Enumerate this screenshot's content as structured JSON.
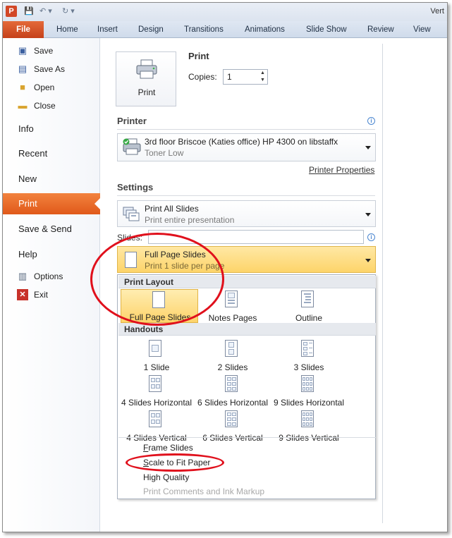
{
  "titlebar": {
    "title_fragment": "Vert"
  },
  "tabs": [
    "File",
    "Home",
    "Insert",
    "Design",
    "Transitions",
    "Animations",
    "Slide Show",
    "Review",
    "View"
  ],
  "nav": {
    "items_small_top": [
      "Save",
      "Save As",
      "Open",
      "Close"
    ],
    "items_big": [
      "Info",
      "Recent",
      "New",
      "Print",
      "Save & Send",
      "Help"
    ],
    "items_small_bottom": [
      "Options",
      "Exit"
    ],
    "active": "Print"
  },
  "print": {
    "heading": "Print",
    "button_label": "Print",
    "copies_label": "Copies:",
    "copies_value": "1"
  },
  "printer": {
    "heading": "Printer",
    "name": "3rd floor Briscoe (Katies office) HP 4300 on libstaffx",
    "status": "Toner Low",
    "properties_link": "Printer Properties"
  },
  "settings": {
    "heading": "Settings",
    "range_main": "Print All Slides",
    "range_sub": "Print entire presentation",
    "slides_label": "Slides:",
    "slides_value": "",
    "layout_main": "Full Page Slides",
    "layout_sub": "Print 1 slide per page"
  },
  "gallery": {
    "print_layout_heading": "Print Layout",
    "print_layout_items": [
      "Full Page Slides",
      "Notes Pages",
      "Outline"
    ],
    "handouts_heading": "Handouts",
    "handout_items": [
      "1 Slide",
      "2 Slides",
      "3 Slides",
      "4 Slides Horizontal",
      "6 Slides Horizontal",
      "9 Slides Horizontal",
      "4 Slides Vertical",
      "6 Slides Vertical",
      "9 Slides Vertical"
    ],
    "options": {
      "frame_first": "F",
      "frame_rest": "rame Slides",
      "scale_first": "S",
      "scale_rest": "cale to Fit Paper",
      "high_quality": "High Quality",
      "comments": "Print Comments and Ink Markup"
    }
  },
  "colors": {
    "file_tab": "#d24726",
    "active_nav": "#e9692a",
    "highlight": "#fdd46a",
    "annotation": "#e0101c"
  }
}
